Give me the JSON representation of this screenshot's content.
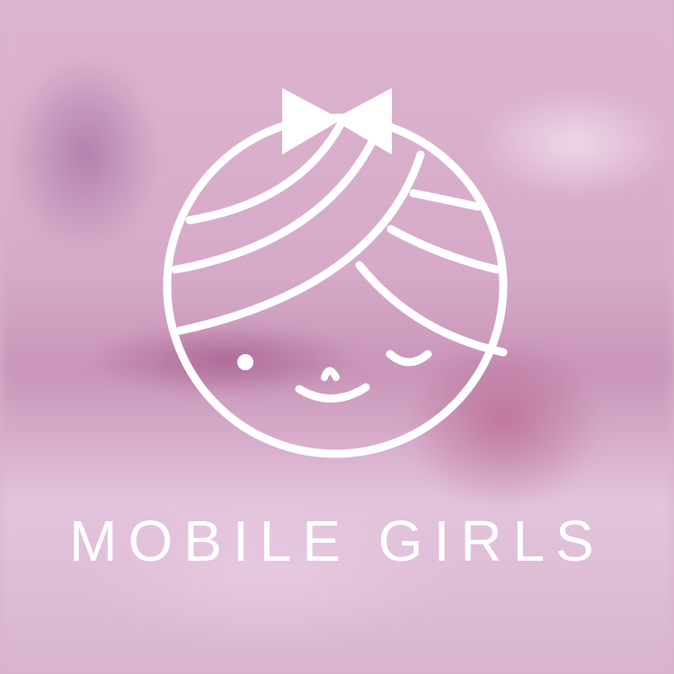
{
  "brand": {
    "name": "MOBILE GIRLS",
    "logo_icon": "girl-face-with-bow-icon",
    "logo_color": "#ffffff",
    "background_color": "#d9b3cd"
  }
}
